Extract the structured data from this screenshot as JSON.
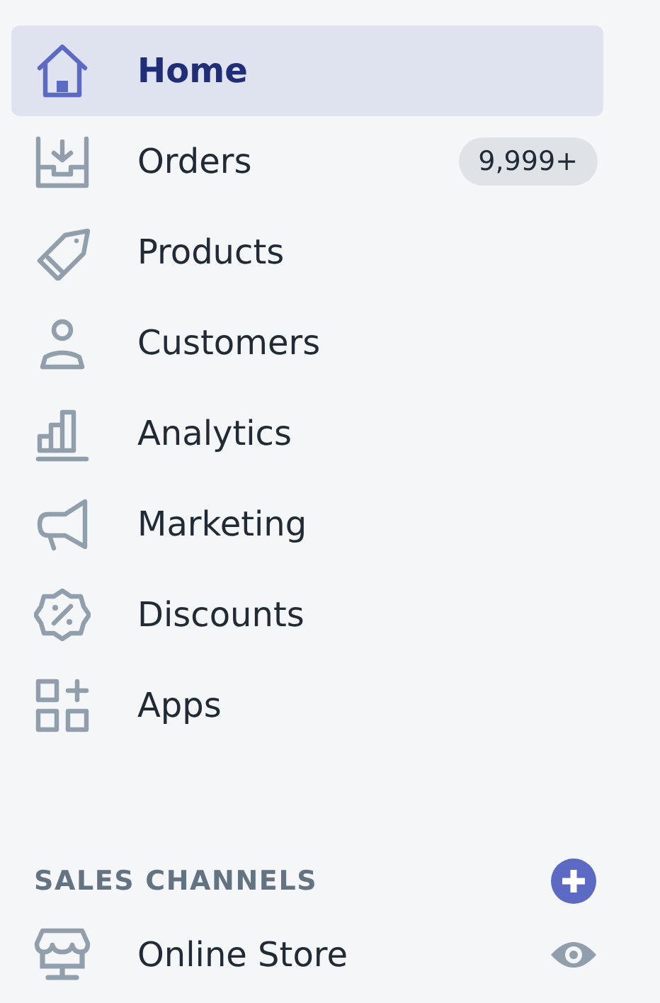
{
  "nav_items": [
    {
      "label": "Home",
      "selected": true
    },
    {
      "label": "Orders",
      "selected": false,
      "badge": "9,999+"
    },
    {
      "label": "Products",
      "selected": false
    },
    {
      "label": "Customers",
      "selected": false
    },
    {
      "label": "Analytics",
      "selected": false
    },
    {
      "label": "Marketing",
      "selected": false
    },
    {
      "label": "Discounts",
      "selected": false
    },
    {
      "label": "Apps",
      "selected": false
    }
  ],
  "sales_channels": {
    "heading": "SALES CHANNELS",
    "items": [
      {
        "label": "Online Store",
        "selected": false
      }
    ]
  }
}
